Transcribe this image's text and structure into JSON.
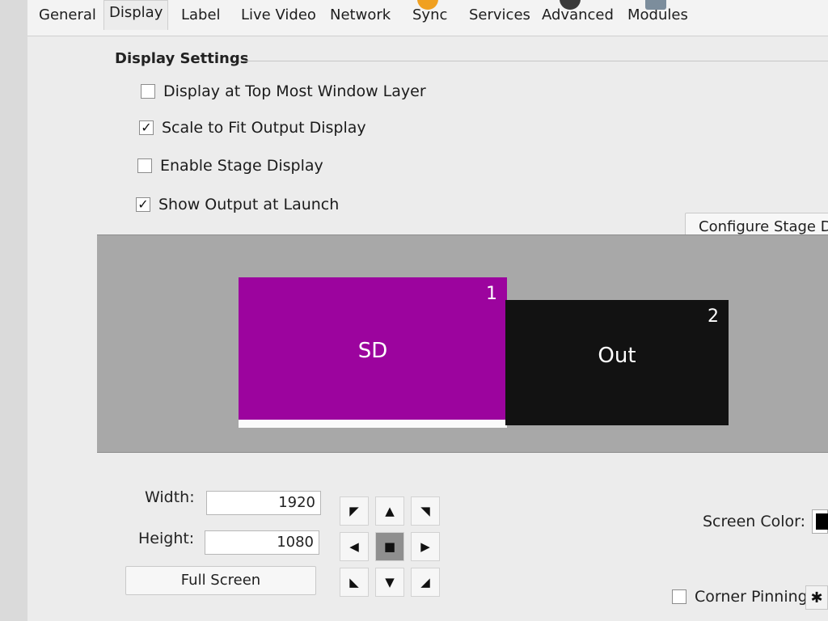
{
  "tabs": [
    {
      "label": "General"
    },
    {
      "label": "Display"
    },
    {
      "label": "Label"
    },
    {
      "label": "Live Video"
    },
    {
      "label": "Network"
    },
    {
      "label": "Sync"
    },
    {
      "label": "Services"
    },
    {
      "label": "Advanced"
    },
    {
      "label": "Modules"
    }
  ],
  "active_tab": "Display",
  "display_settings": {
    "title": "Display Settings",
    "options": [
      {
        "label": "Display at Top Most Window Layer",
        "checked": false
      },
      {
        "label": "Scale to Fit Output Display",
        "checked": true
      },
      {
        "label": "Enable Stage Display",
        "checked": false
      },
      {
        "label": "Show Output at Launch",
        "checked": true
      }
    ],
    "configure_button": "Configure Stage Dis"
  },
  "screens": [
    {
      "name": "SD",
      "number": "1",
      "color": "#9c049e"
    },
    {
      "name": "Out",
      "number": "2",
      "color": "#121212"
    }
  ],
  "form": {
    "width_label": "Width:",
    "width_value": "1920",
    "height_label": "Height:",
    "height_value": "1080",
    "full_screen_button": "Full Screen",
    "screen_color_label": "Screen Color:",
    "screen_color": "#000000",
    "corner_pinning_label": "Corner Pinning",
    "corner_pinning_checked": false
  },
  "icons": {
    "arrows": [
      "arrow-up-left-icon",
      "arrow-up-icon",
      "arrow-up-right-icon",
      "arrow-left-icon",
      "center-stop-icon",
      "arrow-right-icon",
      "arrow-down-left-icon",
      "arrow-down-icon",
      "arrow-down-right-icon"
    ],
    "gear": "gear-icon"
  },
  "colors": {
    "accent_sd": "#9c049e",
    "preview_bg": "#a8a8a8"
  }
}
